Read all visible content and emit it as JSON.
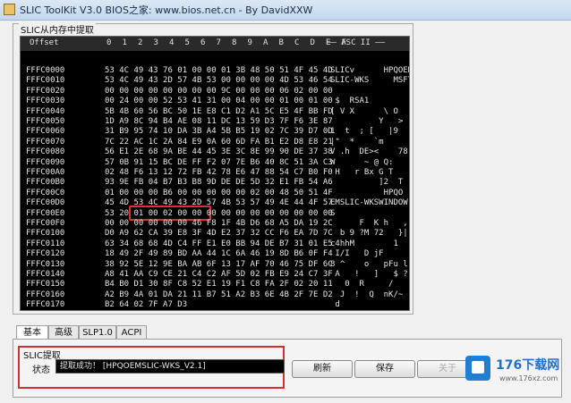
{
  "window": {
    "title": "SLIC ToolKit V3.0    BIOS之家: www.bios.net.cn  - By DavidXXW"
  },
  "hex_view": {
    "group_label": "SLIC从内存中提取",
    "header": {
      "offset": "Offset",
      "cols": [
        "0",
        "1",
        "2",
        "3",
        "4",
        "5",
        "6",
        "7",
        "8",
        "9",
        "A",
        "B",
        "C",
        "D",
        "E",
        "F"
      ],
      "ascii": "—— ASC II ——"
    },
    "rows": [
      {
        "offset": "FFFC0000",
        "hex": "53 4C 49 43 76 01 00 00 01 3B 48 50 51 4F 45 4D",
        "ascii": "SLICv      HPQOEM"
      },
      {
        "offset": "FFFC0010",
        "hex": "53 4C 49 43 2D 57 4B 53 00 00 00 00 4D 53 46 54",
        "ascii": "SLIC-WKS     MSFT"
      },
      {
        "offset": "FFFC0020",
        "hex": "00 00 00 00 00 00 00 00 9C 00 00 00 06 02 00 00",
        "ascii": ""
      },
      {
        "offset": "FFFC0030",
        "hex": "00 24 00 00 52 53 41 31 00 04 00 00 01 00 01 00",
        "ascii": " $  RSA1"
      },
      {
        "offset": "FFFC0040",
        "hex": "5B 4B 60 56 BC 50 1E E8 C1 D2 A1 5C E5 4F BB FD",
        "ascii": "[ V X      \\ O"
      },
      {
        "offset": "FFFC0050",
        "hex": "1D A9 8C 94 B4 AE 08 11 DC 13 59 D3 7F F6 3E 87",
        "ascii": "          Y   >"
      },
      {
        "offset": "FFFC0060",
        "hex": "31 B9 95 74 10 DA 3B A4 5B B5 19 02 7C 39 D7 0D",
        "ascii": "1  t  ; [   |9"
      },
      {
        "offset": "FFFC0070",
        "hex": "7C 22 AC 1C 2A 84 E9 0A 60 6D FA B1 E2 D8 E8 21",
        "ascii": "|\"  *    `m     !"
      },
      {
        "offset": "FFFC0080",
        "hex": "56 E1 2E 68 9A BE 44 45 3E 3C 8E 99 90 DE 37 38",
        "ascii": "V .h  DE><    78"
      },
      {
        "offset": "FFFC0090",
        "hex": "57 0B 91 15 BC DE FF F2 07 7E B6 40 8C 51 3A C3",
        "ascii": "W      ~ @ Q:"
      },
      {
        "offset": "FFFC00A0",
        "hex": "02 48 F6 13 12 72 FB 42 78 E6 47 88 54 C7 B0 F0",
        "ascii": " H   r Bx G T"
      },
      {
        "offset": "FFFC00B0",
        "hex": "93 9E FB 04 B7 B3 B8 9D DE DE 5D 32 E1 FB 54 A6",
        "ascii": "          ]2  T"
      },
      {
        "offset": "FFFC00C0",
        "hex": "01 00 00 00 B6 00 00 00 00 00 02 00 48 50 51 4F",
        "ascii": "           HPQO"
      },
      {
        "offset": "FFFC00D0",
        "hex": "45 4D 53 4C 49 43 2D 57 4B 53 57 49 4E 44 4F 57",
        "ascii": "EMSLIC-WKSWINDOW"
      },
      {
        "offset": "FFFC00E0",
        "hex": "53 20 01 00 02 00 00 00 00 00 00 00 00 00 00 00",
        "ascii": "S"
      },
      {
        "offset": "FFFC00F0",
        "hex": "00 00 00 00 00 00 46 F8 1F 4B D6 68 A5 DA 19 2C",
        "ascii": "      F  K h   ,"
      },
      {
        "offset": "FFFC0100",
        "hex": "D0 A9 62 CA 39 E8 3F 4D E2 37 32 CC F6 EA 7D 7C",
        "ascii": "  b 9 ?M 72   }|"
      },
      {
        "offset": "FFFC0110",
        "hex": "63 34 68 68 4D C4 FF E1 E0 BB 94 DE B7 31 01 E5",
        "ascii": "c4hhM        1"
      },
      {
        "offset": "FFFC0120",
        "hex": "18 49 2F 49 89 BD AA 44 1C 6A 46 19 8D B6 0F F4",
        "ascii": " I/I   D jF"
      },
      {
        "offset": "FFFC0130",
        "hex": "38 92 5E 12 9E BA AB 6F 13 17 AF 70 46 75 DF 6C",
        "ascii": "8 ^    o   pFu l"
      },
      {
        "offset": "FFFC0140",
        "hex": "A8 41 AA C9 CE 21 C4 C2 AF 5D 02 FB E9 24 C7 3F",
        "ascii": " A   !   ]   $ ?"
      },
      {
        "offset": "FFFC0150",
        "hex": "B4 B0 D1 30 8F C8 52 E1 19 F1 C8 FA 2F 02 20 11",
        "ascii": "   0  R     /"
      },
      {
        "offset": "FFFC0160",
        "hex": "A2 B9 4A 01 DA 21 11 B7 51 A2 B3 6E 4B 2F 7E D2",
        "ascii": "  J  !  Q  nK/~"
      },
      {
        "offset": "FFFC0170",
        "hex": "B2 64 02 7F A7 D3",
        "ascii": " d"
      }
    ]
  },
  "tabs": [
    {
      "label": "基本"
    },
    {
      "label": "高级"
    },
    {
      "label": "SLP1.0"
    },
    {
      "label": "ACPI"
    }
  ],
  "slic_panel": {
    "group_label": "SLIC提取",
    "status_label": "状态",
    "status_value": "提取成功！ [HPQOEMSLIC-WKS_V2.1]"
  },
  "buttons": {
    "refresh": "刷新",
    "save": "保存",
    "third": "关于"
  },
  "watermark": {
    "brand": "176下载网",
    "url": "www.176xz.com"
  },
  "colors": {
    "hex_bg": "#000000",
    "highlight": "#e0302c",
    "brand": "#1e6fd0"
  }
}
